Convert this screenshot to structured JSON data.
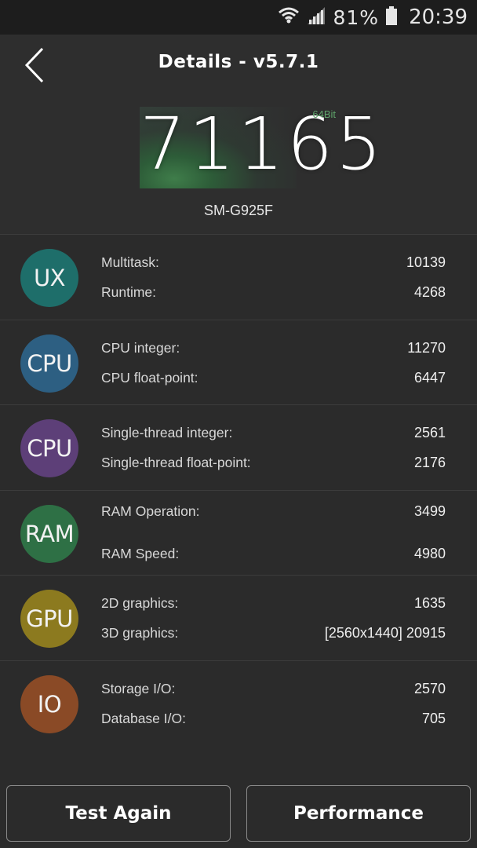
{
  "status_bar": {
    "battery_percent": "81%",
    "time": "20:39"
  },
  "header": {
    "title": "Details - v5.7.1",
    "score": "71165",
    "bit_label": "64Bit",
    "device": "SM-G925F"
  },
  "categories": [
    {
      "badge": "UX",
      "color": "#1e6e6a",
      "metrics": [
        {
          "label": "Multitask:",
          "value": "10139"
        },
        {
          "label": "Runtime:",
          "value": "4268"
        }
      ]
    },
    {
      "badge": "CPU",
      "color": "#2d5f82",
      "metrics": [
        {
          "label": "CPU integer:",
          "value": "11270"
        },
        {
          "label": "CPU float-point:",
          "value": "6447"
        }
      ]
    },
    {
      "badge": "CPU",
      "color": "#5d3f78",
      "metrics": [
        {
          "label": "Single-thread integer:",
          "value": "2561"
        },
        {
          "label": "Single-thread float-point:",
          "value": "2176"
        }
      ]
    },
    {
      "badge": "RAM",
      "color": "#2e7045",
      "metrics": [
        {
          "label": "RAM Operation:",
          "value": "3499"
        },
        {
          "label": "RAM Speed:",
          "value": "4980"
        }
      ]
    },
    {
      "badge": "GPU",
      "color": "#8c7a1f",
      "metrics": [
        {
          "label": "2D graphics:",
          "value": "1635"
        },
        {
          "label": "3D graphics:",
          "value": "[2560x1440] 20915"
        }
      ]
    },
    {
      "badge": "IO",
      "color": "#8a4a26",
      "metrics": [
        {
          "label": "Storage I/O:",
          "value": "2570"
        },
        {
          "label": "Database I/O:",
          "value": "705"
        }
      ]
    }
  ],
  "buttons": {
    "test_again": "Test Again",
    "performance": "Performance"
  },
  "icons": {
    "back": "chevron-left-icon",
    "wifi": "wifi-icon",
    "signal": "signal-icon",
    "battery": "battery-icon"
  }
}
